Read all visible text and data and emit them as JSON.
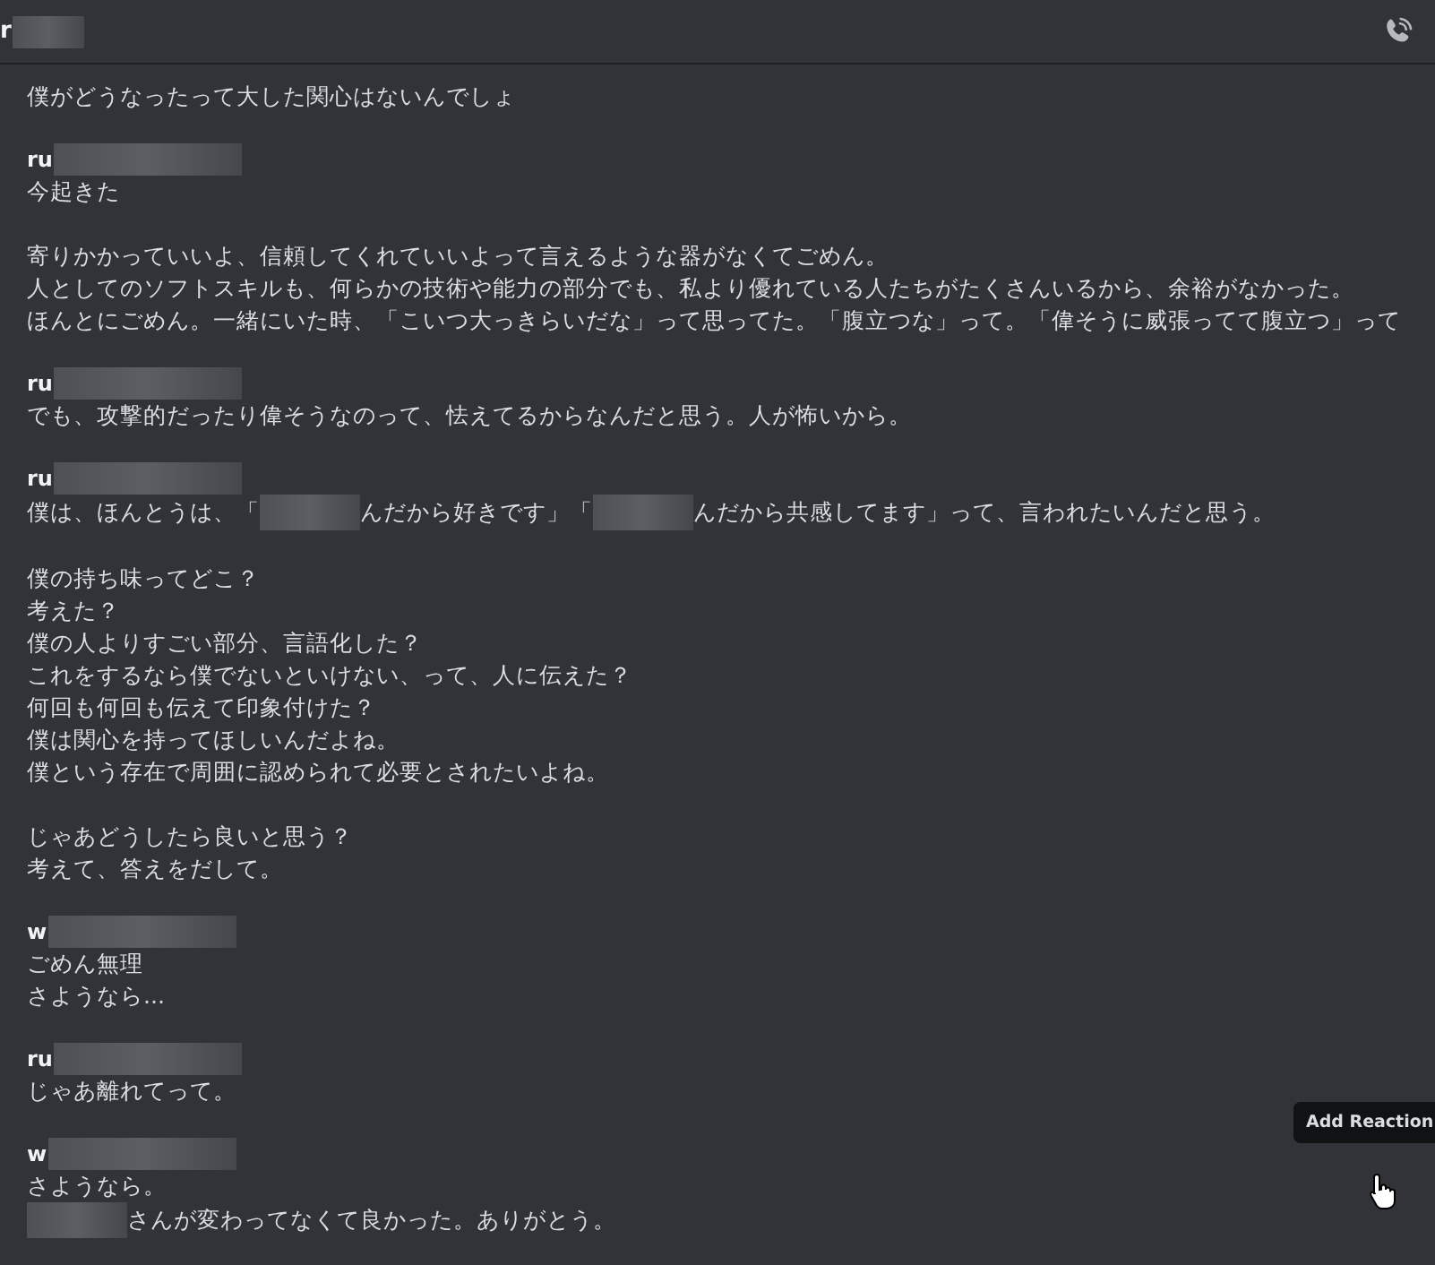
{
  "header": {
    "user_initial": "r"
  },
  "messages": [
    {
      "paragraphs": [
        [
          [
            "僕がどうなったって大した関心はないんでしょ"
          ]
        ]
      ]
    },
    {
      "author": "ru",
      "paragraphs": [
        [
          [
            "今起きた"
          ]
        ],
        [
          [
            "寄りかかっていいよ、信頼してくれていいよって言えるような器がなくてごめん。"
          ],
          [
            "人としてのソフトスキルも、何らかの技術や能力の部分でも、私より優れている人たちがたくさんいるから、余裕がなかった。"
          ],
          [
            "ほんとにごめん。一緒にいた時、「こいつ大っきらいだな」って思ってた。「腹立つな」って。「偉そうに威張ってて腹立つ」って"
          ]
        ]
      ]
    },
    {
      "author": "ru",
      "paragraphs": [
        [
          [
            "でも、攻撃的だったり偉そうなのって、怯えてるからなんだと思う。人が怖いから。"
          ]
        ]
      ]
    },
    {
      "author": "ru",
      "paragraphs": [
        [
          [
            "僕は、ほんとうは、「",
            {
              "kind": "redacted"
            },
            "んだから好きです」「",
            {
              "kind": "redacted"
            },
            "んだから共感してます」って、言われたいんだと思う。"
          ]
        ],
        [
          [
            "僕の持ち味ってどこ？"
          ],
          [
            "考えた？"
          ],
          [
            "僕の人よりすごい部分、言語化した？"
          ],
          [
            "これをするなら僕でないといけない、って、人に伝えた？"
          ],
          [
            "何回も何回も伝えて印象付けた？"
          ],
          [
            "僕は関心を持ってほしいんだよね。"
          ],
          [
            "僕という存在で周囲に認められて必要とされたいよね。"
          ]
        ],
        [
          [
            "じゃあどうしたら良いと思う？"
          ],
          [
            "考えて、答えをだして。"
          ]
        ]
      ]
    },
    {
      "author": "w",
      "paragraphs": [
        [
          [
            "ごめん無理"
          ],
          [
            "さようなら..."
          ]
        ]
      ]
    },
    {
      "author": "ru",
      "paragraphs": [
        [
          [
            "じゃあ離れてって。"
          ]
        ]
      ]
    },
    {
      "author": "w",
      "paragraphs": [
        [
          [
            "さようなら。"
          ],
          [
            {
              "kind": "redacted"
            },
            "さんが変わってなくて良かった。ありがとう。"
          ]
        ]
      ]
    }
  ],
  "tooltip": "Add Reaction"
}
